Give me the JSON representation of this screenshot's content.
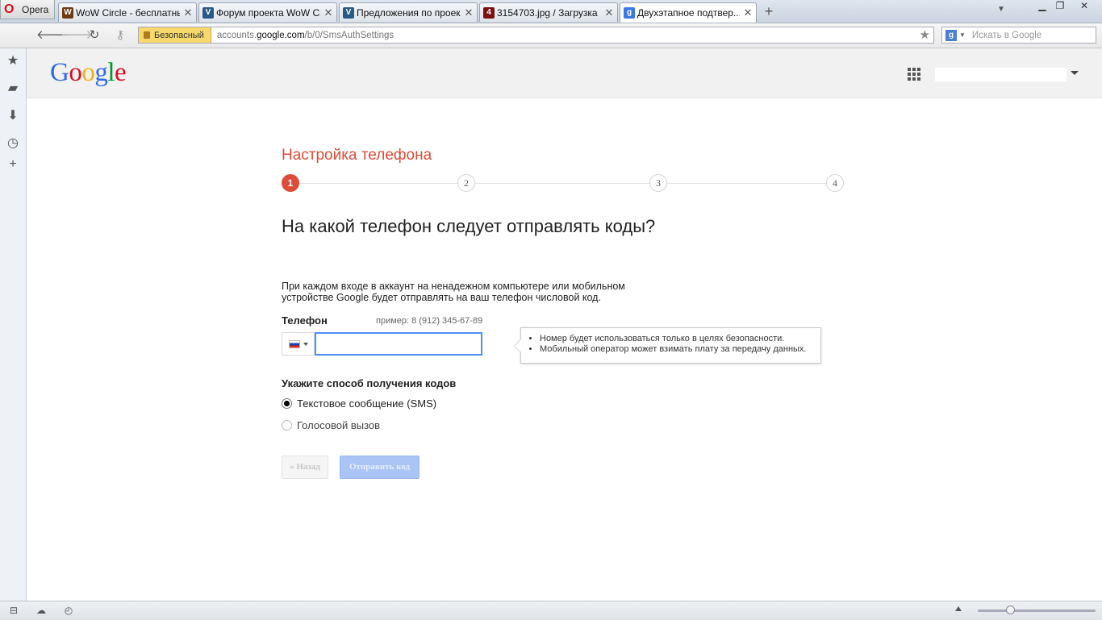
{
  "browser": {
    "menu_label": "Opera",
    "tabs": [
      {
        "title": "WoW Circle - бесплатны...",
        "favicon_color": "#6b3a10",
        "favicon": "W"
      },
      {
        "title": "Форум проекта WoW Ci...",
        "favicon_color": "#2a5a84",
        "favicon": "V"
      },
      {
        "title": "Предложения по проек...",
        "favicon_color": "#2a5a84",
        "favicon": "V"
      },
      {
        "title": "3154703.jpg / Загрузка ...",
        "favicon_color": "#7a1010",
        "favicon": "4"
      },
      {
        "title": "Двухэтапное подтвер...",
        "favicon_color": "#3b78e7",
        "favicon": "g"
      }
    ],
    "active_tab_index": 4,
    "secure_label": "Безопасный",
    "url_prefix": "accounts.",
    "url_domain": "google.com",
    "url_path": "/b/0/SmsAuthSettings",
    "search_placeholder": "Искать в Google",
    "icons": {
      "back": "arrow-left-icon",
      "forward": "arrow-right-icon",
      "reload": "reload-icon",
      "key": "key-icon",
      "bookmark": "star-icon",
      "panel": [
        "star-icon",
        "notes-icon",
        "downloads-icon",
        "history-icon",
        "add-icon"
      ]
    }
  },
  "google": {
    "logo_letters": [
      {
        "ch": "G",
        "color": "#3369e8"
      },
      {
        "ch": "o",
        "color": "#d50f25"
      },
      {
        "ch": "o",
        "color": "#eeb211"
      },
      {
        "ch": "g",
        "color": "#3369e8"
      },
      {
        "ch": "l",
        "color": "#009925"
      },
      {
        "ch": "e",
        "color": "#d50f25"
      }
    ]
  },
  "setup": {
    "title": "Настройка телефона",
    "steps": [
      "1",
      "2",
      "3",
      "4"
    ],
    "current_step": 1,
    "question": "На какой телефон следует отправлять коды?",
    "intro": "При каждом входе в аккаунт на ненадежном компьютере или мобильном устройстве Google будет отправлять на ваш телефон числовой код.",
    "phone_label": "Телефон",
    "phone_example": "пример: 8 (912) 345-67-89",
    "phone_value": "",
    "country": "RU",
    "tooltip": [
      "Номер будет использоваться только в целях безопасности.",
      "Мобильный оператор может взимать плату за передачу данных."
    ],
    "method_label": "Укажите способ получения кодов",
    "methods": [
      {
        "label": "Текстовое сообщение (SMS)",
        "checked": true
      },
      {
        "label": "Голосовой вызов",
        "checked": false
      }
    ],
    "back_button": "« Назад",
    "send_button": "Отправить код"
  },
  "colors": {
    "accent_red": "#dd4b39",
    "input_focus": "#4d90fe",
    "button_disabled_blue": "#a9c4f5"
  }
}
